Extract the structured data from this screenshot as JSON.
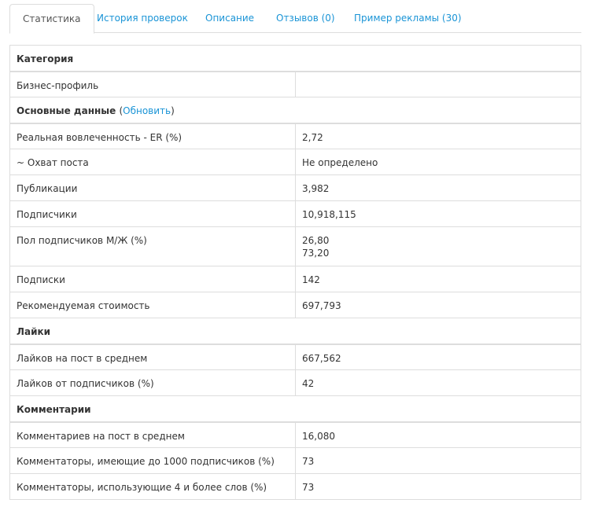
{
  "tabs": [
    {
      "label": "Статистика"
    },
    {
      "label": "История проверок"
    },
    {
      "label": "Описание"
    },
    {
      "label": "Отзывов (0)"
    },
    {
      "label": "Пример рекламы (30)"
    }
  ],
  "sections": {
    "category": {
      "title": "Категория"
    },
    "business_profile": {
      "label": "Бизнес-профиль",
      "value": ""
    },
    "main": {
      "title": "Основные данные",
      "paren_open": "(",
      "refresh": "Обновить",
      "paren_close": ")"
    },
    "likes": {
      "title": "Лайки"
    },
    "comments": {
      "title": "Комментарии"
    }
  },
  "rows": {
    "er": {
      "label": "Реальная вовлеченность - ER (%)",
      "value": "2,72"
    },
    "reach": {
      "label": "~ Охват поста",
      "value": "Не определено"
    },
    "posts": {
      "label": "Публикации",
      "value": "3,982"
    },
    "followers": {
      "label": "Подписчики",
      "value": "10,918,115"
    },
    "gender": {
      "label": "Пол подписчиков М/Ж (%)",
      "value_m": "26,80",
      "value_f": "73,20"
    },
    "following": {
      "label": "Подписки",
      "value": "142"
    },
    "price": {
      "label": "Рекомендуемая стоимость",
      "value": "697,793"
    },
    "likes_avg": {
      "label": "Лайков на пост в среднем",
      "value": "667,562"
    },
    "likes_followers": {
      "label": "Лайков от подписчиков (%)",
      "value": "42"
    },
    "comments_avg": {
      "label": "Комментариев на пост в среднем",
      "value": "16,080"
    },
    "commenters_small": {
      "label": "Комментаторы, имеющие до 1000 подписчиков (%)",
      "value": "73"
    },
    "commenters_words": {
      "label": "Комментаторы, использующие 4 и более слов (%)",
      "value": "73"
    }
  }
}
